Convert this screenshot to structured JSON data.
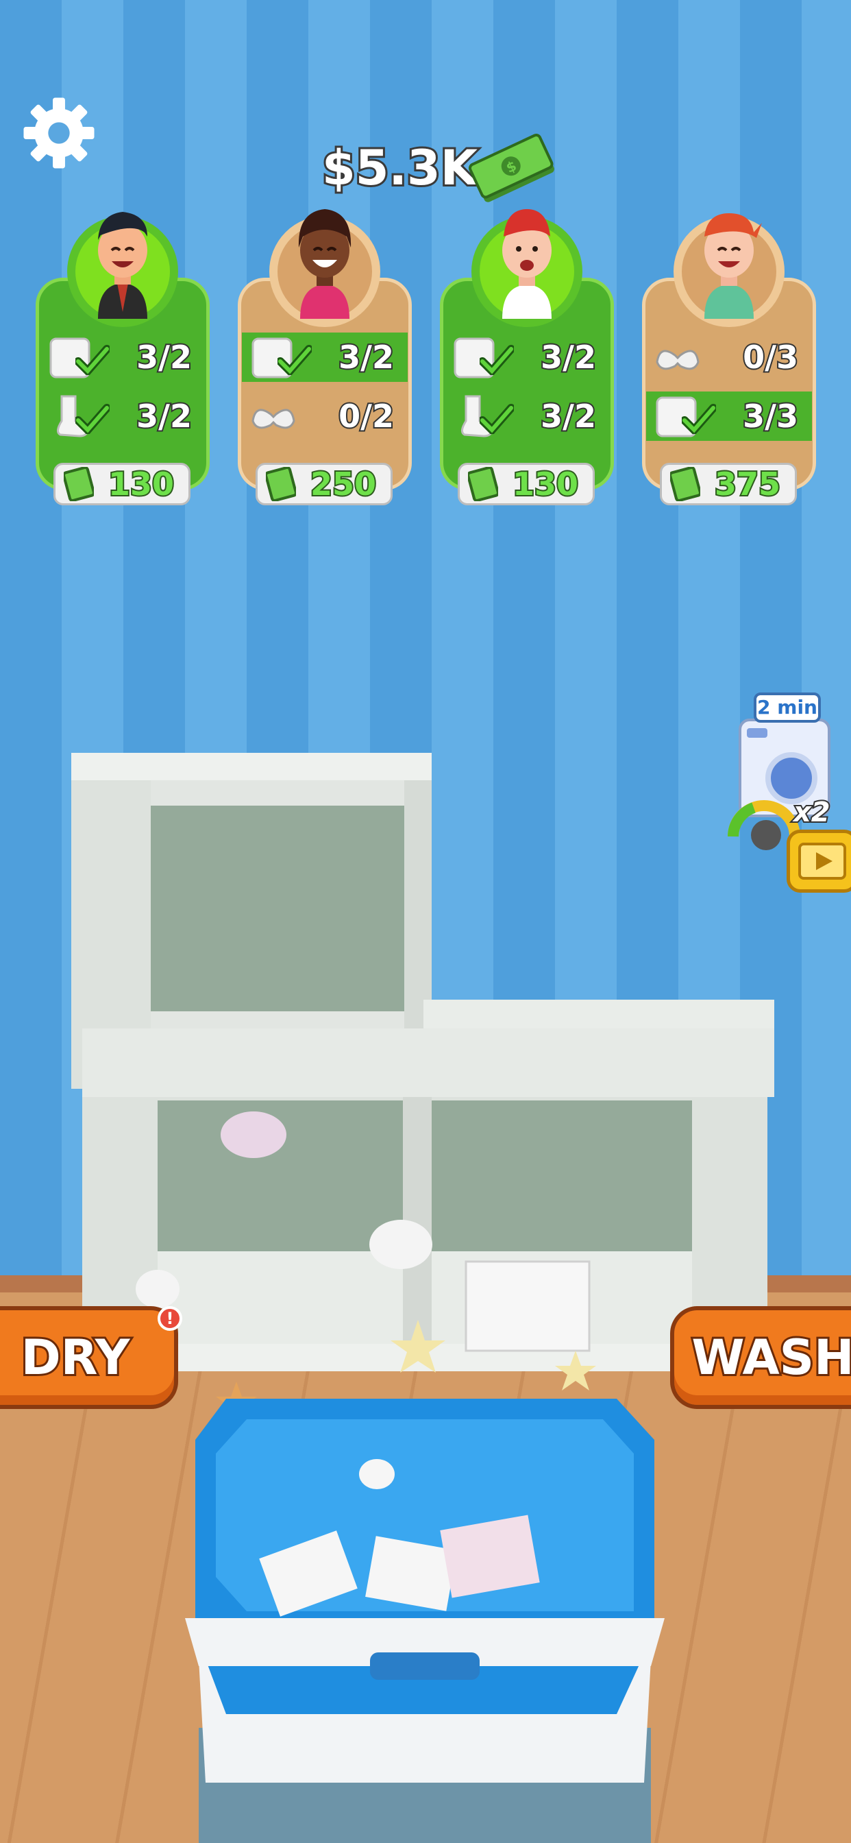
{
  "hud": {
    "settings_icon": "gear-icon",
    "money": "$5.3K",
    "money_icon": "cash-bundle-icon"
  },
  "customers": [
    {
      "bg": "green",
      "rows": [
        {
          "item": "shirt-icon",
          "count": "3/2",
          "done": true,
          "highlight": false
        },
        {
          "item": "sock-icon",
          "count": "3/2",
          "done": true,
          "highlight": false
        }
      ],
      "reward": "130"
    },
    {
      "bg": "tan",
      "rows": [
        {
          "item": "shirt-icon",
          "count": "3/2",
          "done": true,
          "highlight": true
        },
        {
          "item": "bra-icon",
          "count": "0/2",
          "done": false,
          "highlight": false
        }
      ],
      "reward": "250"
    },
    {
      "bg": "green",
      "rows": [
        {
          "item": "shirt-icon",
          "count": "3/2",
          "done": true,
          "highlight": false
        },
        {
          "item": "sock-icon",
          "count": "3/2",
          "done": true,
          "highlight": false
        }
      ],
      "reward": "130"
    },
    {
      "bg": "tan",
      "rows": [
        {
          "item": "bra-icon",
          "count": "0/3",
          "done": false,
          "highlight": false
        },
        {
          "item": "shirt-icon",
          "count": "3/3",
          "done": true,
          "highlight": true
        }
      ],
      "reward": "375"
    }
  ],
  "buttons": {
    "dry": "DRY",
    "wash": "WASH",
    "dry_alert": "!"
  },
  "ad_offer": {
    "time": "2 min",
    "multiplier": "x2",
    "icon": "washing-machine-icon",
    "play_icon": "video-play-icon"
  },
  "colors": {
    "wall": "#4f9fdc",
    "floor": "#d49b66",
    "button": "#f07a1e",
    "card_green": "#4cb22c",
    "card_tan": "#d7a76d",
    "reward_text": "#6ee04a"
  }
}
